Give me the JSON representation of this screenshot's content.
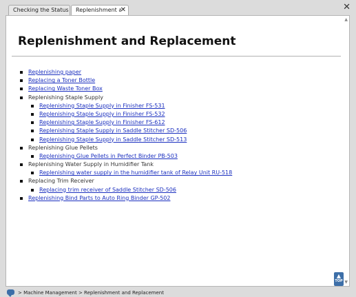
{
  "tabs": [
    {
      "label": "Checking the Status ..."
    },
    {
      "label": "Replenishment and Replacement",
      "close": "✕"
    }
  ],
  "window_close": "✕",
  "page": {
    "title": "Replenishment and Replacement"
  },
  "toc": {
    "i0": {
      "label": "Replenishing paper"
    },
    "i1": {
      "label": "Replacing a Toner Bottle"
    },
    "i2": {
      "label": "Replacing Waste Toner Box"
    },
    "i3": {
      "label": "Replenishing Staple Supply"
    },
    "i4": {
      "label": "Replenishing Staple Supply in Finisher FS-531"
    },
    "i5": {
      "label": "Replenishing Staple Supply in Finisher FS-532"
    },
    "i6": {
      "label": "Replenishing Staple Supply in Finisher FS-612"
    },
    "i7": {
      "label": "Replenishing Staple Supply in Saddle Stitcher SD-506"
    },
    "i8": {
      "label": "Replenishing Staple Supply in Saddle Stitcher SD-513"
    },
    "i9": {
      "label": "Replenishing Glue Pellets"
    },
    "i10": {
      "label": "Replenishing Glue Pellets in Perfect Binder PB-503"
    },
    "i11": {
      "label": "Replenishing Water Supply in Humidifier Tank"
    },
    "i12": {
      "label": "Replenishing water supply in the humidifier tank of Relay Unit RU-518"
    },
    "i13": {
      "label": "Replacing Trim Receiver"
    },
    "i14": {
      "label": "Replacing trim receiver of Saddle Stitcher SD-506"
    },
    "i15": {
      "label": "Replenishing Bind Parts to Auto Ring Binder GP-502"
    }
  },
  "top_button": {
    "arrow": "▲",
    "label": "TOP"
  },
  "scrollbar": {
    "up": "▲",
    "down": "▼"
  },
  "breadcrumb": "> Machine Management > Replenishment and Replacement"
}
